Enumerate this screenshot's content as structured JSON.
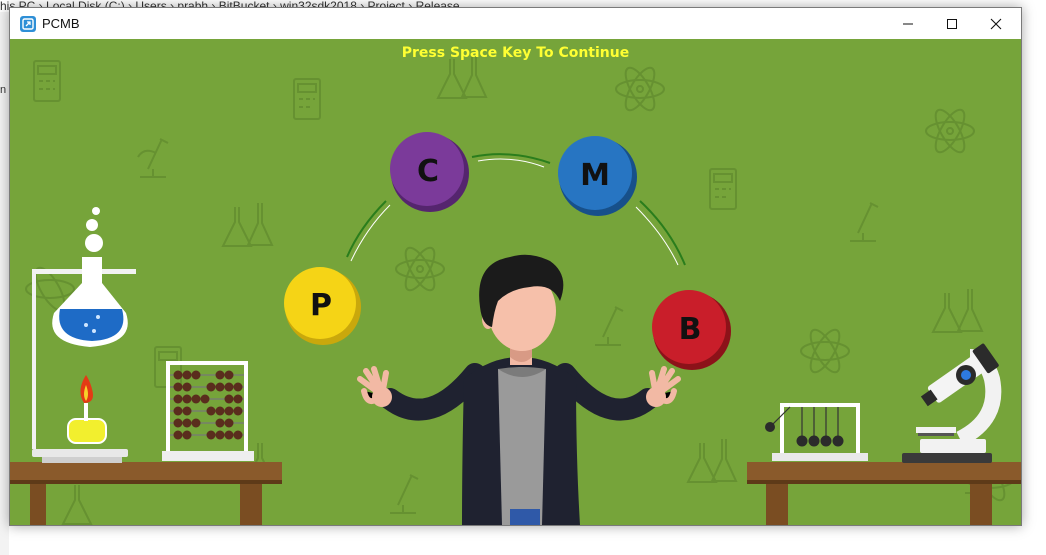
{
  "background_explorer": {
    "breadcrumb": [
      "his PC",
      "Local Disk (C:)",
      "Users",
      "prabh",
      "BitBucket",
      "win32sdk2018",
      "Project",
      "Release"
    ],
    "side_text": "n"
  },
  "window": {
    "title": "PCMB",
    "icon": "app-icon",
    "controls": {
      "minimize": "minimize-icon",
      "maximize": "maximize-icon",
      "close": "close-icon"
    }
  },
  "game": {
    "prompt": "Press Space Key To Continue",
    "prompt_color": "#ffff33",
    "background_color": "#76a43a",
    "balls": [
      {
        "letter": "P",
        "color": "#f5d416"
      },
      {
        "letter": "C",
        "color": "#7b3a9a"
      },
      {
        "letter": "M",
        "color": "#2775c2"
      },
      {
        "letter": "B",
        "color": "#c91e2a"
      }
    ]
  }
}
